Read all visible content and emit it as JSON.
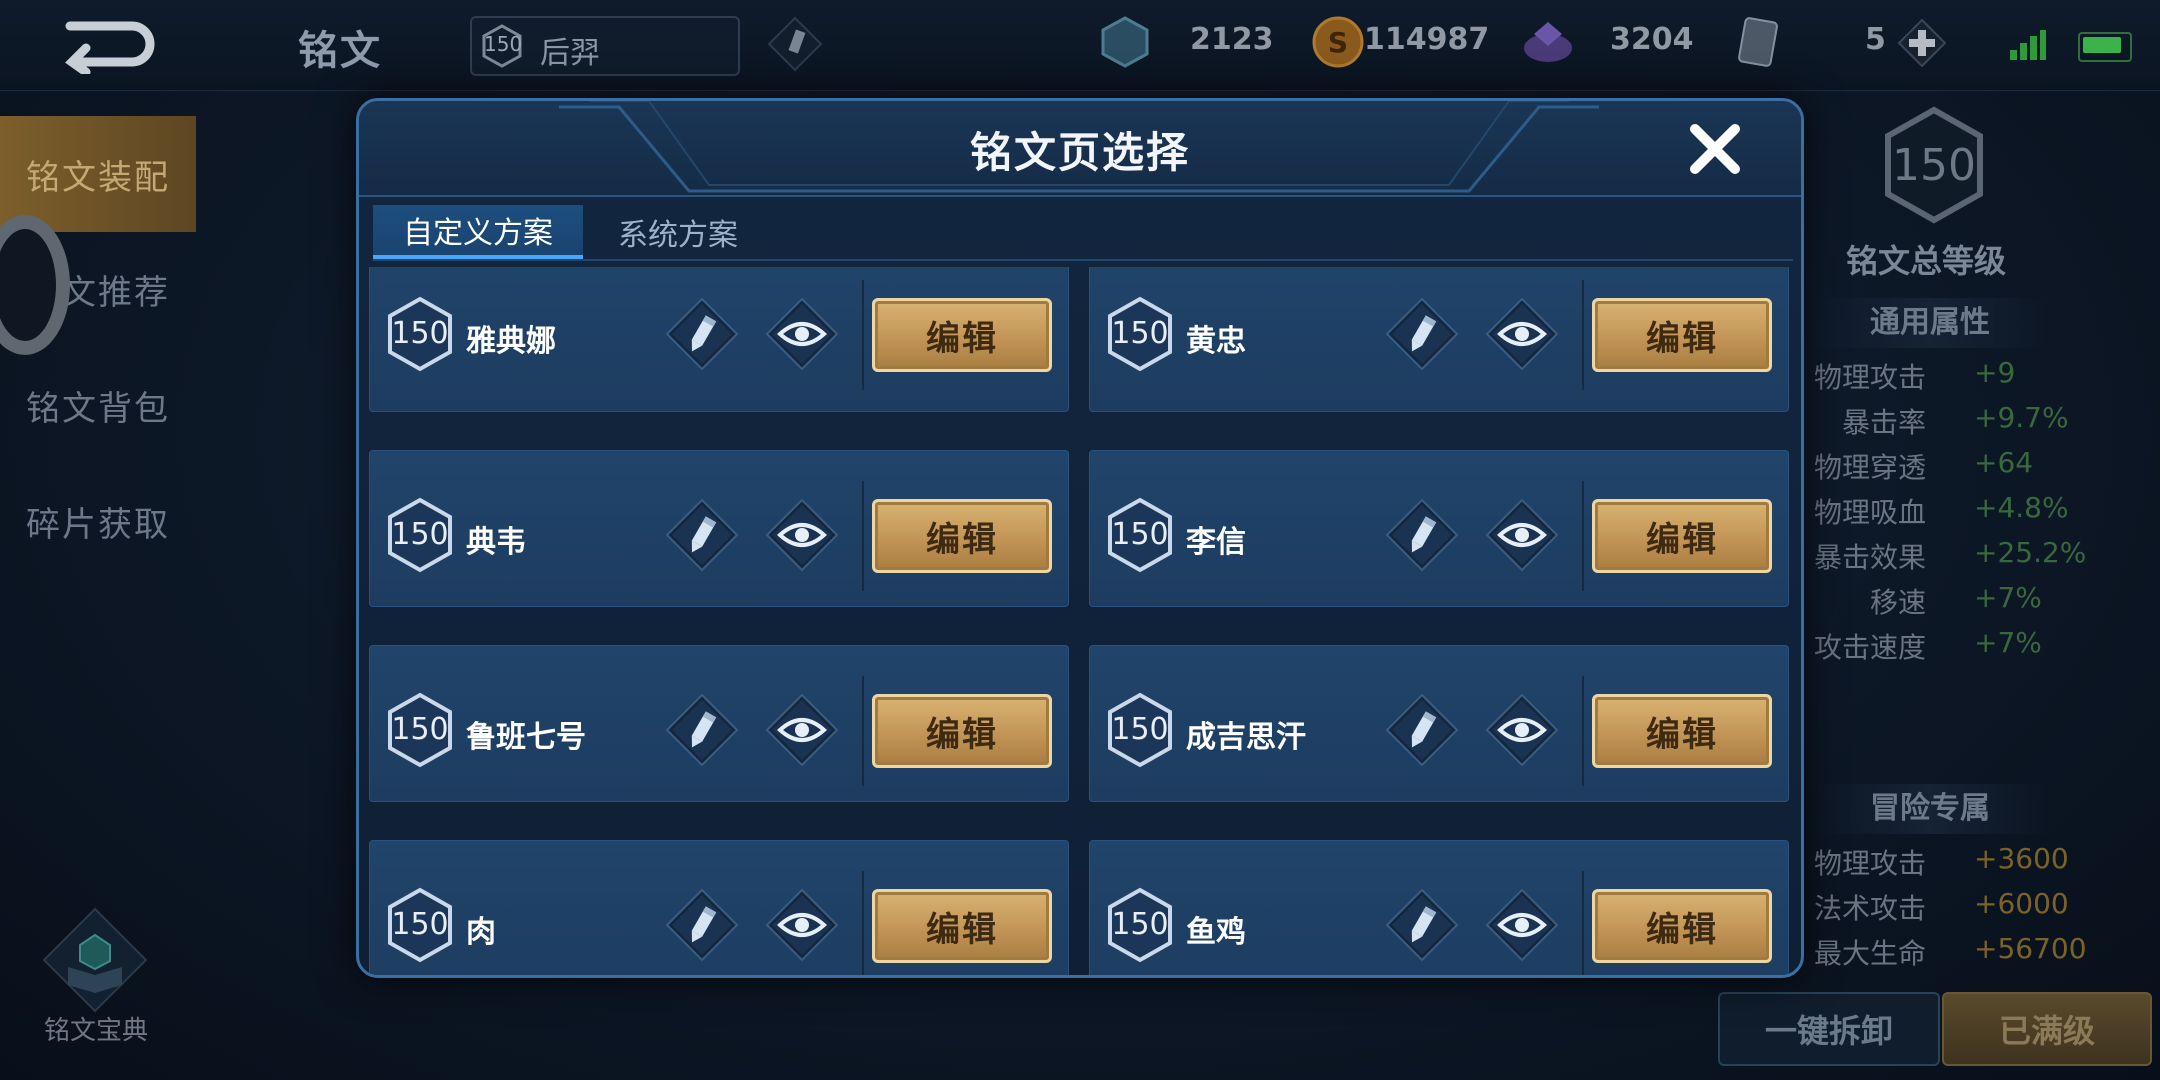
{
  "topbar": {
    "title": "铭文",
    "hero_level": "150",
    "hero_name": "后羿",
    "currencies": [
      {
        "icon": "crystal-icon",
        "value": "2123"
      },
      {
        "icon": "gold-coin-icon",
        "value": "114987"
      },
      {
        "icon": "gem-icon",
        "value": "3204"
      },
      {
        "icon": "card-icon",
        "value": "5"
      }
    ]
  },
  "sidebar": {
    "items": [
      "铭文装配",
      "铭文推荐",
      "铭文背包",
      "碎片获取"
    ],
    "active_index": 0,
    "codex_label": "铭文宝典"
  },
  "right_panel": {
    "total_level": "150",
    "total_label": "铭文总等级",
    "general_header": "通用属性",
    "general_stats": [
      {
        "name": "物理攻击",
        "value": "+9"
      },
      {
        "name": "暴击率",
        "value": "+9.7%"
      },
      {
        "name": "物理穿透",
        "value": "+64"
      },
      {
        "name": "物理吸血",
        "value": "+4.8%"
      },
      {
        "name": "暴击效果",
        "value": "+25.2%"
      },
      {
        "name": "移速",
        "value": "+7%"
      },
      {
        "name": "攻击速度",
        "value": "+7%"
      }
    ],
    "adventure_header": "冒险专属",
    "adventure_stats": [
      {
        "name": "物理攻击",
        "value": "+3600"
      },
      {
        "name": "法术攻击",
        "value": "+6000"
      },
      {
        "name": "最大生命",
        "value": "+56700"
      }
    ],
    "dismantle_label": "一键拆卸",
    "maxed_label": "已满级"
  },
  "modal": {
    "title": "铭文页选择",
    "tabs": [
      "自定义方案",
      "系统方案"
    ],
    "active_tab": 0,
    "edit_label": "编辑",
    "pages": [
      {
        "level": "150",
        "name": "雅典娜"
      },
      {
        "level": "150",
        "name": "黄忠"
      },
      {
        "level": "150",
        "name": "典韦"
      },
      {
        "level": "150",
        "name": "李信"
      },
      {
        "level": "150",
        "name": "鲁班七号"
      },
      {
        "level": "150",
        "name": "成吉思汗"
      },
      {
        "level": "150",
        "name": "肉"
      },
      {
        "level": "150",
        "name": "鱼鸡"
      }
    ]
  }
}
